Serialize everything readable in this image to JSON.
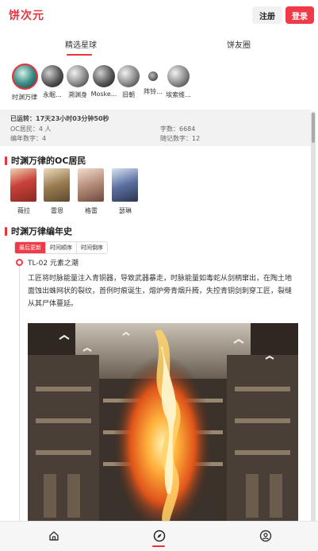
{
  "app": {
    "logo": "饼次元"
  },
  "header": {
    "login_label": "注册",
    "register_label": "登录"
  },
  "tabs": [
    {
      "label": "精选星球",
      "active": true
    },
    {
      "label": "饼友圈",
      "active": false
    }
  ],
  "worlds": [
    {
      "name": "时渊万律",
      "selected": true
    },
    {
      "name": "永眠..."
    },
    {
      "name": "溯渊身"
    },
    {
      "name": "Moske..."
    },
    {
      "name": "旧朝"
    },
    {
      "name": "阵铃..."
    },
    {
      "name": "埃索维..."
    }
  ],
  "stats": {
    "runtime_label": "已运转：17天23小时03分钟50秒",
    "oc_count": "OC居民：4 人",
    "chars": "字数：6684",
    "works": "编年数字：4",
    "notes": "随记数字：12"
  },
  "sections": {
    "oc_title": "时渊万律的OC居民",
    "chronicle_title": "时渊万律编年史"
  },
  "oc_residents": [
    {
      "name": "薇拉"
    },
    {
      "name": "雷恩"
    },
    {
      "name": "格雷"
    },
    {
      "name": "瑟琳"
    }
  ],
  "filters": [
    {
      "label": "最后更新",
      "active": true
    },
    {
      "label": "时间顺序",
      "active": false
    },
    {
      "label": "时间倒序",
      "active": false
    }
  ],
  "timeline": [
    {
      "title": "TL-02 元素之潮",
      "text": "工匠将时脉能量注入青铜器，导致武器暴走，时脉能量如毒蛇从剑柄窜出，在陶土地面蚀出蛛网状的裂纹，首例时痕诞生，熔炉旁青烟升腾，失控青铜剑刺穿工匠，裂缝从其尸体蔓延。"
    }
  ],
  "colors": {
    "accent": "#e8323c",
    "chip_active": "#ef3a48"
  },
  "bottom_nav": [
    {
      "icon": "home-icon"
    },
    {
      "icon": "compass-icon",
      "active": true
    },
    {
      "icon": "user-icon"
    }
  ]
}
